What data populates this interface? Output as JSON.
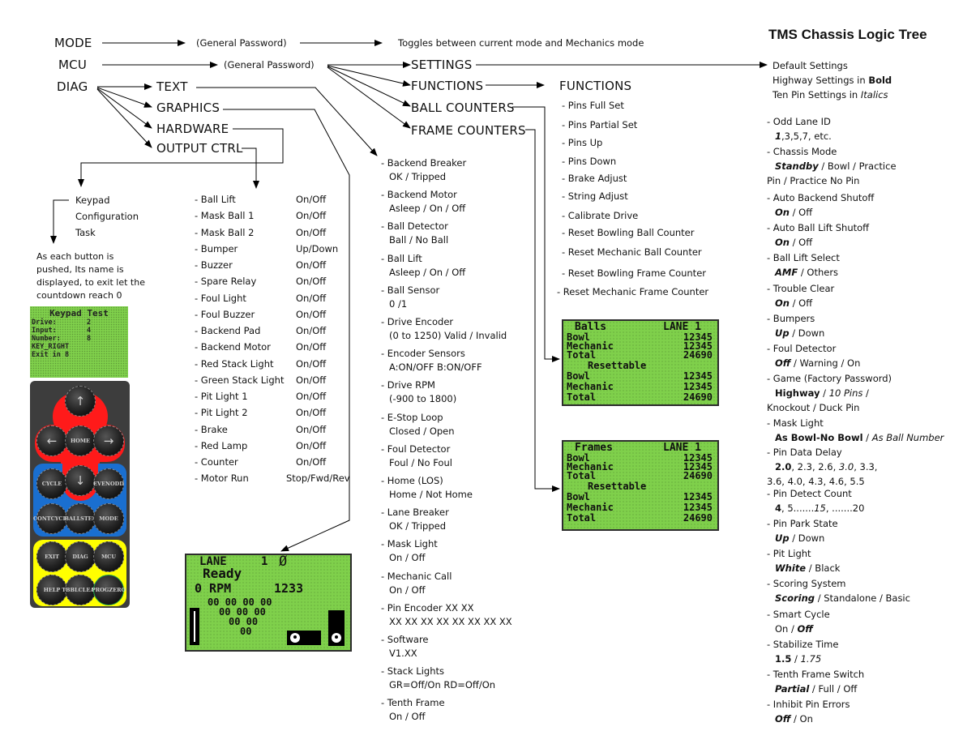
{
  "title": "TMS Chassis Logic Tree",
  "top_menu": {
    "mode": "MODE",
    "mcu": "MCU",
    "diag": "DIAG",
    "mode_password": "(General Password)",
    "mode_result": "Toggles between current mode and Mechanics mode",
    "mcu_password": "(General Password)"
  },
  "mcu_branches": {
    "settings": "SETTINGS",
    "functions": "FUNCTIONS",
    "ball_counters": "BALL COUNTERS",
    "frame_counters": "FRAME  COUNTERS"
  },
  "diag_branches": {
    "text": "TEXT",
    "graphics": "GRAPHICS",
    "hardware": "HARDWARE",
    "output_ctrl": "OUTPUT CTRL"
  },
  "keypad_task": {
    "lines": [
      "Keypad",
      "Configuration",
      "Task"
    ],
    "note_lines": [
      "As each button is",
      "pushed, Its name is",
      "displayed, to exit let the",
      "countdown reach 0"
    ]
  },
  "keypad_test_display": {
    "title": "Keypad Test",
    "rows": [
      {
        "label": "Drive:",
        "value": "2"
      },
      {
        "label": "Input:",
        "value": "4"
      },
      {
        "label": "Number:",
        "value": "8"
      },
      {
        "label": "KEY_RIGHT",
        "value": ""
      },
      {
        "label": "Exit in",
        "value": "8"
      }
    ]
  },
  "keypad_buttons": {
    "up": "↑",
    "left": "←",
    "home": "HOME",
    "right": "→",
    "down": "↓",
    "cycle": "CYCLE",
    "even_odd": [
      "EVEN",
      "ODD"
    ],
    "cont_cycle": [
      "CONT",
      "CYCLE"
    ],
    "ball_step": [
      "BALL",
      "STEP"
    ],
    "mode": "MODE",
    "exit": "EXIT",
    "diag": "DIAG",
    "mcu": "MCU",
    "help": "HELP",
    "tbl_clear": [
      "TBBL",
      "CLEAR"
    ],
    "prog_zero": [
      "PROG",
      "ZERO"
    ]
  },
  "keypad_colors": {
    "nav": "#ff1a1a",
    "cycle": "#1a6fd0",
    "menu": "#ffff00",
    "body": "#3d3d3d",
    "lcd": "#7fd04b"
  },
  "output_ctrl": [
    {
      "name": "- Ball Lift",
      "value": "On/Off"
    },
    {
      "name": "- Mask Ball 1",
      "value": "On/Off"
    },
    {
      "name": "- Mask Ball 2",
      "value": "On/Off"
    },
    {
      "name": "- Bumper",
      "value": "Up/Down"
    },
    {
      "name": "- Buzzer",
      "value": "On/Off"
    },
    {
      "name": "- Spare Relay",
      "value": "On/Off"
    },
    {
      "name": "- Foul Light",
      "value": "On/Off"
    },
    {
      "name": "- Foul Buzzer",
      "value": "On/Off"
    },
    {
      "name": "- Backend Pad",
      "value": "On/Off"
    },
    {
      "name": "- Backend Motor",
      "value": "On/Off"
    },
    {
      "name": "- Red Stack Light",
      "value": "On/Off"
    },
    {
      "name": "- Green Stack Light",
      "value": "On/Off"
    },
    {
      "name": "- Pit Light 1",
      "value": "On/Off"
    },
    {
      "name": "- Pit Light 2",
      "value": "On/Off"
    },
    {
      "name": "- Brake",
      "value": "On/Off"
    },
    {
      "name": "- Red Lamp",
      "value": "On/Off"
    },
    {
      "name": "- Counter",
      "value": "On/Off"
    },
    {
      "name": "- Motor Run",
      "value": "Stop/Fwd/Rev"
    }
  ],
  "text_diag": [
    {
      "name": "- Backend Breaker",
      "value": "OK / Tripped"
    },
    {
      "name": "- Backend Motor",
      "value": "Asleep / On / Off"
    },
    {
      "name": "- Ball Detector",
      "value": "Ball / No Ball"
    },
    {
      "name": "- Ball Lift",
      "value": "Asleep / On / Off"
    },
    {
      "name": "- Ball Sensor",
      "value": "0 /1"
    },
    {
      "name": "- Drive Encoder",
      "value": "(0 to 1250) Valid / Invalid"
    },
    {
      "name": "- Encoder Sensors",
      "value": "A:ON/OFF B:ON/OFF"
    },
    {
      "name": "- Drive RPM",
      "value": "(-900 to 1800)"
    },
    {
      "name": "- E-Stop Loop",
      "value": "Closed / Open"
    },
    {
      "name": "- Foul Detector",
      "value": "Foul / No Foul"
    },
    {
      "name": "- Home (LOS)",
      "value": "Home / Not Home"
    },
    {
      "name": "- Lane Breaker",
      "value": "OK / Tripped"
    },
    {
      "name": "- Mask Light",
      "value": "On / Off"
    },
    {
      "name": "- Mechanic Call",
      "value": "On / Off"
    },
    {
      "name": "- Pin Encoder XX XX",
      "value": "XX XX XX XX XX XX XX XX"
    },
    {
      "name": "- Software",
      "value": "V1.XX"
    },
    {
      "name": "- Stack Lights",
      "value": "GR=Off/On RD=Off/On"
    },
    {
      "name": "- Tenth Frame",
      "value": "On / Off"
    }
  ],
  "functions": {
    "heading": "FUNCTIONS",
    "items": [
      "- Pins Full Set",
      "- Pins Partial Set",
      "- Pins Up",
      "- Pins Down",
      "- Brake Adjust",
      "- String Adjust",
      "- Calibrate Drive",
      "- Reset Bowling Ball Counter",
      "- Reset Mechanic Ball Counter",
      "- Reset Bowling Frame Counter",
      "- Reset Mechanic Frame Counter"
    ]
  },
  "balls_display": {
    "title": "Balls",
    "lane": "LANE 1",
    "rows": [
      {
        "label": "Bowl",
        "value": "12345"
      },
      {
        "label": "Mechanic",
        "value": "12345"
      },
      {
        "label": "Total",
        "value": "24690"
      }
    ],
    "resettable_label": "Resettable",
    "resettable_rows": [
      {
        "label": "Bowl",
        "value": "12345"
      },
      {
        "label": "Mechanic",
        "value": "12345"
      },
      {
        "label": "Total",
        "value": "24690"
      }
    ]
  },
  "frames_display": {
    "title": "Frames",
    "lane": "LANE 1",
    "rows": [
      {
        "label": "Bowl",
        "value": "12345"
      },
      {
        "label": "Mechanic",
        "value": "12345"
      },
      {
        "label": "Total",
        "value": "24690"
      }
    ],
    "resettable_label": "Resettable",
    "resettable_rows": [
      {
        "label": "Bowl",
        "value": "12345"
      },
      {
        "label": "Mechanic",
        "value": "12345"
      },
      {
        "label": "Total",
        "value": "24690"
      }
    ]
  },
  "lane_display": {
    "lane_label": "LANE",
    "lane_number": "1",
    "symbol": "Ø",
    "status": "Ready",
    "rpm": "0 RPM",
    "count": "1233",
    "pin_rows": [
      "00 00 00 00",
      "00 00 00",
      "00 00",
      "00"
    ]
  },
  "settings_legend": {
    "line1": "Default Settings",
    "line2_prefix": "Highway Settings in ",
    "line2_bold": "Bold",
    "line3_prefix": "Ten Pin Settings in ",
    "line3_italic": "Italics"
  },
  "settings": [
    {
      "name": "- Odd Lane ID",
      "segments": [
        {
          "t": "1",
          "s": "both"
        },
        {
          "t": ",3,5,7, etc.",
          "s": ""
        }
      ]
    },
    {
      "name": "- Chassis Mode",
      "segments": [
        {
          "t": "Standby",
          "s": "both"
        },
        {
          "t": " / Bowl / Practice",
          "s": ""
        }
      ],
      "wrap": "Pin / Practice No Pin"
    },
    {
      "name": "- Auto Backend Shutoff",
      "segments": [
        {
          "t": "On",
          "s": "both"
        },
        {
          "t": " / Off",
          "s": ""
        }
      ]
    },
    {
      "name": "- Auto Ball Lift Shutoff",
      "segments": [
        {
          "t": "On",
          "s": "both"
        },
        {
          "t": " / Off",
          "s": ""
        }
      ]
    },
    {
      "name": "- Ball Lift Select",
      "segments": [
        {
          "t": "AMF",
          "s": "both"
        },
        {
          "t": " / Others",
          "s": ""
        }
      ]
    },
    {
      "name": "- Trouble Clear",
      "segments": [
        {
          "t": "On",
          "s": "both"
        },
        {
          "t": " / Off",
          "s": ""
        }
      ]
    },
    {
      "name": "- Bumpers",
      "segments": [
        {
          "t": "Up",
          "s": "both"
        },
        {
          "t": " / Down",
          "s": ""
        }
      ]
    },
    {
      "name": "- Foul Detector",
      "segments": [
        {
          "t": "Off",
          "s": "both"
        },
        {
          "t": " / Warning / On",
          "s": ""
        }
      ]
    },
    {
      "name": "- Game  (Factory Password)",
      "segments": [
        {
          "t": "Highway",
          "s": "bold"
        },
        {
          "t": " / ",
          "s": ""
        },
        {
          "t": "10 Pins",
          "s": "italic"
        },
        {
          "t": " /",
          "s": ""
        }
      ],
      "wrap": "Knockout / Duck Pin"
    },
    {
      "name": "- Mask Light",
      "segments": [
        {
          "t": "As Bowl-No Bowl",
          "s": "bold"
        },
        {
          "t": " / ",
          "s": ""
        },
        {
          "t": "As Ball Number",
          "s": "italic"
        }
      ]
    },
    {
      "name": "- Pin Data Delay",
      "segments": [
        {
          "t": "2.0",
          "s": "bold"
        },
        {
          "t": ", 2.3, 2.6, ",
          "s": ""
        },
        {
          "t": "3.0",
          "s": "italic"
        },
        {
          "t": ", 3.3,",
          "s": ""
        }
      ],
      "wrap": "3.6, 4.0, 4.3, 4.6, 5.5"
    },
    {
      "name": "- Pin Detect Count",
      "segments": [
        {
          "t": "4",
          "s": "bold"
        },
        {
          "t": ", 5.......",
          "s": ""
        },
        {
          "t": "15",
          "s": "italic"
        },
        {
          "t": ", .......20",
          "s": ""
        }
      ]
    },
    {
      "name": "- Pin Park State",
      "segments": [
        {
          "t": "Up",
          "s": "both"
        },
        {
          "t": " / Down",
          "s": ""
        }
      ]
    },
    {
      "name": "- Pit Light",
      "segments": [
        {
          "t": "White",
          "s": "both"
        },
        {
          "t": " / Black",
          "s": ""
        }
      ]
    },
    {
      "name": "- Scoring System",
      "segments": [
        {
          "t": "Scoring",
          "s": "both"
        },
        {
          "t": " / Standalone / Basic",
          "s": ""
        }
      ]
    },
    {
      "name": "- Smart Cycle",
      "segments": [
        {
          "t": "On / ",
          "s": ""
        },
        {
          "t": "Off",
          "s": "both"
        }
      ]
    },
    {
      "name": "- Stabilize Time",
      "segments": [
        {
          "t": "1.5",
          "s": "bold"
        },
        {
          "t": " / ",
          "s": ""
        },
        {
          "t": "1.75",
          "s": "italic"
        }
      ]
    },
    {
      "name": "- Tenth Frame Switch",
      "segments": [
        {
          "t": "Partial",
          "s": "both"
        },
        {
          "t": " / Full / Off",
          "s": ""
        }
      ]
    },
    {
      "name": "- Inhibit Pin Errors",
      "segments": [
        {
          "t": "Off",
          "s": "both"
        },
        {
          "t": " / On",
          "s": ""
        }
      ]
    }
  ]
}
